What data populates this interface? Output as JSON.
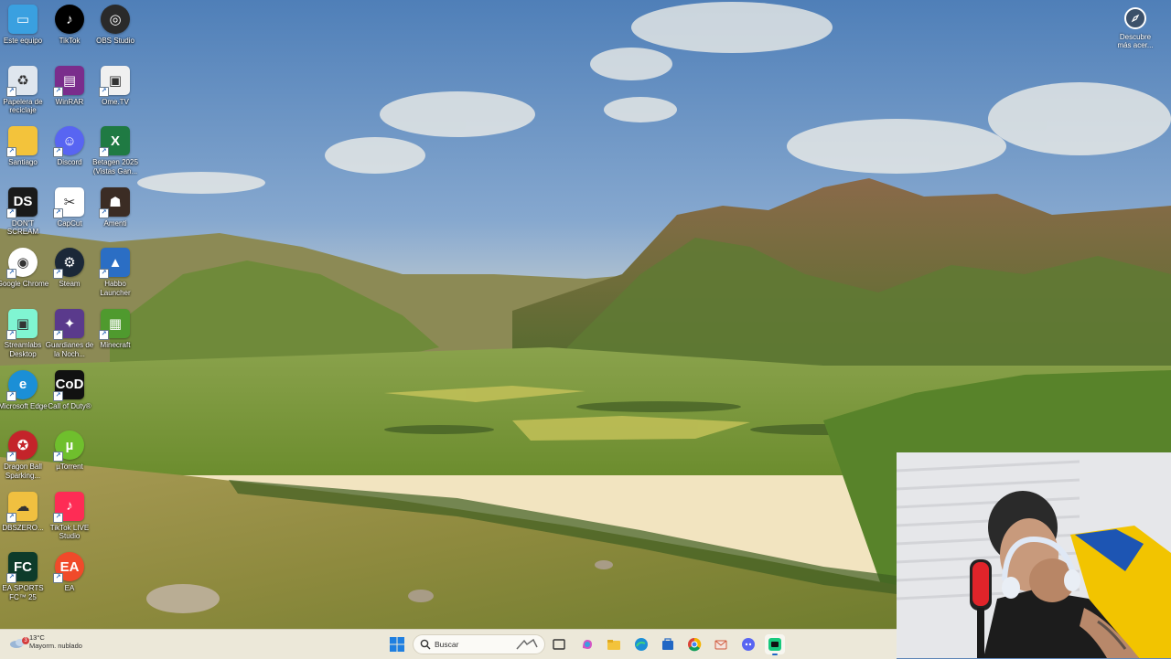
{
  "desktop": {
    "icons": [
      {
        "label": "Este equipo",
        "icon": "computer-icon",
        "color": "#3aa0e0"
      },
      {
        "label": "TikTok",
        "icon": "tiktok-icon",
        "color": "#000000"
      },
      {
        "label": "OBS Studio",
        "icon": "obs-icon",
        "color": "#2a2a2a"
      },
      {
        "label": "Papelera de reciclaje",
        "icon": "recycle-bin-icon",
        "color": "#dfe6ee"
      },
      {
        "label": "WinRAR",
        "icon": "winrar-icon",
        "color": "#7a2d8c"
      },
      {
        "label": "Ome.TV",
        "icon": "ometv-icon",
        "color": "#f0f0f0"
      },
      {
        "label": "Santiago",
        "icon": "folder-icon",
        "color": "#f3c33b"
      },
      {
        "label": "Discord",
        "icon": "discord-icon",
        "color": "#5865f2"
      },
      {
        "label": "Betagen 2025 (Vistas Gan...",
        "icon": "excel-icon",
        "color": "#1f7a43"
      },
      {
        "label": "DON'T SCREAM",
        "icon": "dont-scream-icon",
        "color": "#1a1a1a"
      },
      {
        "label": "CapCut",
        "icon": "capcut-icon",
        "color": "#ffffff"
      },
      {
        "label": "Amenti",
        "icon": "amenti-icon",
        "color": "#3b2c24"
      },
      {
        "label": "Google Chrome",
        "icon": "chrome-icon",
        "color": "#ffffff"
      },
      {
        "label": "Steam",
        "icon": "steam-icon",
        "color": "#1b2838"
      },
      {
        "label": "Habbo Launcher",
        "icon": "habbo-icon",
        "color": "#2b6ec4"
      },
      {
        "label": "Streamlabs Desktop",
        "icon": "streamlabs-icon",
        "color": "#80f5d2"
      },
      {
        "label": "Guardianes de la Noch...",
        "icon": "guardianes-icon",
        "color": "#5a3a8c"
      },
      {
        "label": "Minecraft",
        "icon": "minecraft-icon",
        "color": "#4f9a2e"
      },
      {
        "label": "Microsoft Edge",
        "icon": "edge-icon",
        "color": "#1b8fd6"
      },
      {
        "label": "Call of Duty®",
        "icon": "call-of-duty-icon",
        "color": "#111111"
      },
      {
        "label": "",
        "icon": "blank-slot",
        "color": "transparent"
      },
      {
        "label": "Dragon Ball Sparking...",
        "icon": "dragon-ball-icon",
        "color": "#c4242a"
      },
      {
        "label": "µTorrent",
        "icon": "utorrent-icon",
        "color": "#6fbf2d"
      },
      {
        "label": "",
        "icon": "blank-slot",
        "color": "transparent"
      },
      {
        "label": "DBSZERO...",
        "icon": "dbszero-icon",
        "color": "#f0c040"
      },
      {
        "label": "TikTok LIVE Studio",
        "icon": "tiktok-live-icon",
        "color": "#fe2c55"
      },
      {
        "label": "",
        "icon": "blank-slot",
        "color": "transparent"
      },
      {
        "label": "EA SPORTS FC™ 25",
        "icon": "ea-fc-icon",
        "color": "#0d3b2a"
      },
      {
        "label": "EA",
        "icon": "ea-icon",
        "color": "#f04a2a"
      }
    ]
  },
  "discover_widget": {
    "label": "Descubre más acer..."
  },
  "taskbar": {
    "weather": {
      "badge": "3",
      "temp": "13°C",
      "desc": "Mayorm. nublado"
    },
    "search": {
      "placeholder": "Buscar"
    },
    "apps": [
      {
        "icon": "windows-start-icon",
        "color": "#1f7fe0"
      },
      {
        "icon": "task-view-icon",
        "color": "#333333"
      },
      {
        "icon": "copilot-icon",
        "color": "#d454c4"
      },
      {
        "icon": "file-explorer-icon",
        "color": "#f3c33b"
      },
      {
        "icon": "edge-taskbar-icon",
        "color": "#1b8fd6"
      },
      {
        "icon": "store-icon",
        "color": "#2167c4"
      },
      {
        "icon": "chrome-taskbar-icon",
        "color": "#db4437"
      },
      {
        "icon": "mail-icon",
        "color": "#d0583a"
      },
      {
        "icon": "discord-taskbar-icon",
        "color": "#5865f2"
      },
      {
        "icon": "streamlabs-taskbar-icon",
        "color": "#17c97d"
      }
    ]
  }
}
